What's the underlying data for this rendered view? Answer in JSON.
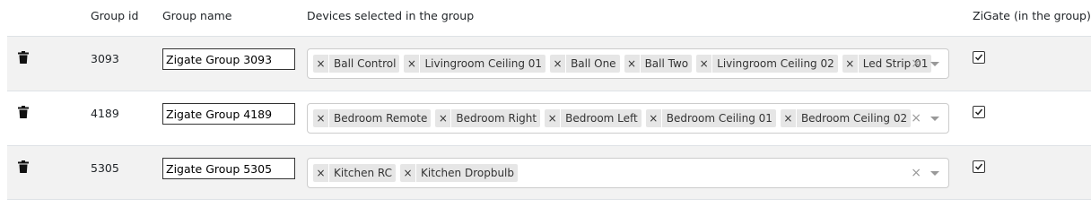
{
  "headers": {
    "group_id": "Group id",
    "group_name": "Group name",
    "devices": "Devices selected in the group",
    "zigate": "ZiGate (in the group)"
  },
  "icons": {
    "delete": "trash-icon",
    "remove_tag": "×",
    "clear": "×",
    "dropdown": "chevron-down-icon",
    "checked": "checkbox-checked"
  },
  "groups": [
    {
      "id": "3093",
      "name": "Zigate Group 3093",
      "devices": [
        "Ball Control",
        "Livingroom Ceiling 01",
        "Ball One",
        "Ball Two",
        "Livingroom Ceiling 02",
        "Led Strip 01"
      ],
      "zigate_checked": true
    },
    {
      "id": "4189",
      "name": "Zigate Group 4189",
      "devices": [
        "Bedroom Remote",
        "Bedroom Right",
        "Bedroom Left",
        "Bedroom Ceiling 01",
        "Bedroom Ceiling 02"
      ],
      "zigate_checked": true
    },
    {
      "id": "5305",
      "name": "Zigate Group 5305",
      "devices": [
        "Kitchen RC",
        "Kitchen Dropbulb"
      ],
      "zigate_checked": true
    }
  ]
}
